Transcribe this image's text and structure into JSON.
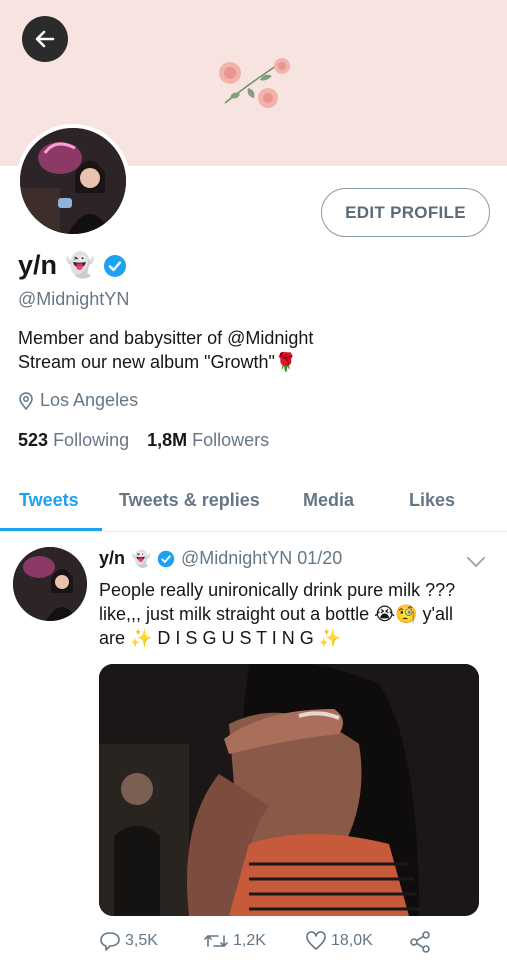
{
  "profile": {
    "name": "y/n",
    "name_emoji": "👻",
    "handle": "@MidnightYN",
    "bio_line1": "Member and babysitter of @Midnight",
    "bio_line2": "Stream our new album \"Growth\"",
    "bio_emoji": "🌹",
    "location": "Los Angeles",
    "following_count": "523",
    "following_label": "Following",
    "followers_count": "1,8M",
    "followers_label": "Followers",
    "edit_label": "EDIT PROFILE"
  },
  "tabs": [
    {
      "label": "Tweets",
      "active": true
    },
    {
      "label": "Tweets & replies",
      "active": false
    },
    {
      "label": "Media",
      "active": false
    },
    {
      "label": "Likes",
      "active": false
    }
  ],
  "tweet": {
    "name": "y/n",
    "name_emoji": "👻",
    "handle_date": "@MidnightYN 01/20",
    "line1": "People really unironically drink pure milk ???",
    "line2": "like,,, just milk straight out a bottle 😭🧐 y'all",
    "line3": "are ✨ D I S G U S T I N G ✨",
    "replies": "3,5K",
    "retweets": "1,2K",
    "likes": "18,0K"
  },
  "colors": {
    "accent": "#1da1f2",
    "banner": "#f7e4e1",
    "muted": "#657786"
  }
}
